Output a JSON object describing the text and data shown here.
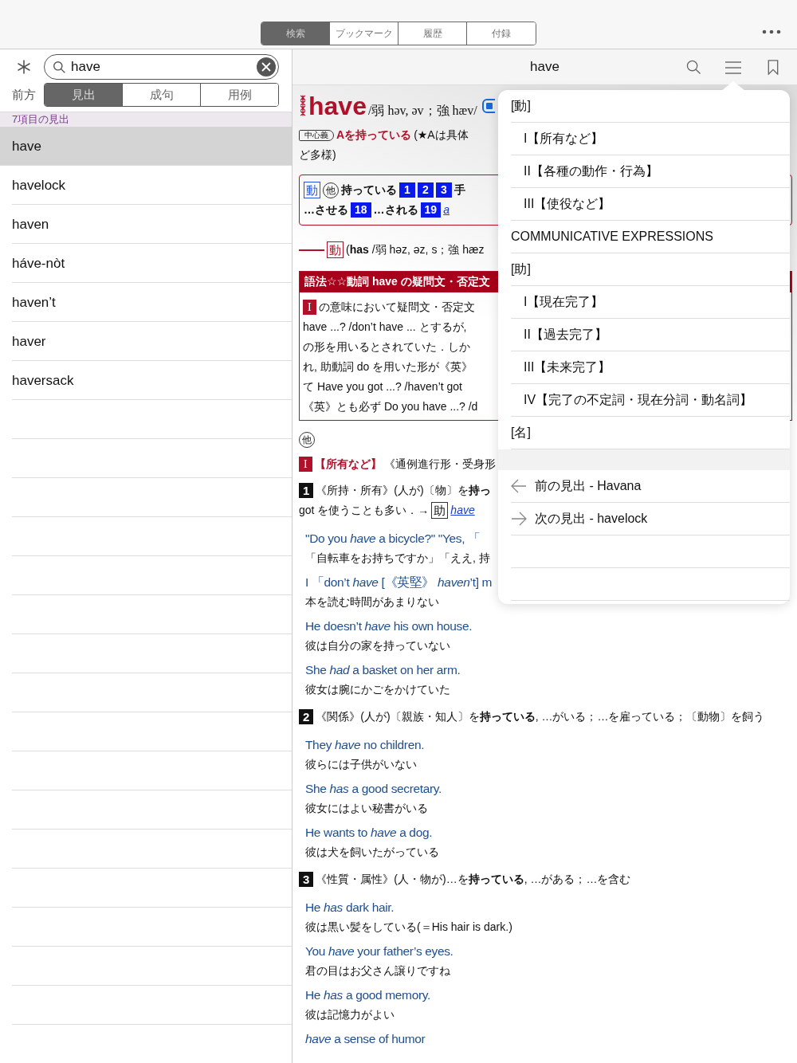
{
  "top_tabs": [
    {
      "label": "検索",
      "selected": true
    },
    {
      "label": "ブックマーク",
      "selected": false
    },
    {
      "label": "履歴",
      "selected": false
    },
    {
      "label": "付録",
      "selected": false
    }
  ],
  "search": {
    "value": "have"
  },
  "filter": {
    "label": "前方",
    "tabs": [
      {
        "label": "見出",
        "selected": true
      },
      {
        "label": "成句",
        "selected": false
      },
      {
        "label": "用例",
        "selected": false
      }
    ]
  },
  "results": {
    "header": "7項目の見出",
    "items": [
      {
        "label": "have",
        "selected": true
      },
      {
        "label": "havelock",
        "selected": false
      },
      {
        "label": "haven",
        "selected": false
      },
      {
        "label": "háve-nòt",
        "selected": false
      },
      {
        "label": "haven’t",
        "selected": false
      },
      {
        "label": "haver",
        "selected": false
      },
      {
        "label": "haversack",
        "selected": false
      }
    ]
  },
  "entry": {
    "title": "have",
    "blocks": [
      {
        "kind": "headword",
        "word": "have",
        "pronunciation": "/弱 həv, əv；強 hæv/"
      },
      {
        "kind": "lines",
        "lines": [
          [
            {
              "kind": "badge",
              "text": "中心義"
            },
            {
              "kind": "red",
              "text": "Aを持っている"
            },
            {
              "kind": "text",
              "text": "(★Aは具体"
            }
          ],
          [
            {
              "kind": "text",
              "text": "ど多様)"
            }
          ]
        ]
      },
      {
        "kind": "box",
        "lines": [
          [
            {
              "kind": "tag",
              "text": "動"
            },
            {
              "kind": "circle",
              "text": "他"
            },
            {
              "kind": "bold",
              "text": "持っている"
            },
            {
              "kind": "num",
              "text": "1"
            },
            {
              "kind": "num",
              "text": "2"
            },
            {
              "kind": "num",
              "text": "3"
            },
            {
              "kind": "bold",
              "text": "手"
            }
          ],
          [
            {
              "kind": "bold",
              "text": "…させる"
            },
            {
              "kind": "num",
              "text": "18"
            },
            {
              "kind": "bold",
              "text": "…される"
            },
            {
              "kind": "num",
              "text": "19"
            },
            {
              "kind": "link",
              "text": "a"
            }
          ]
        ]
      },
      {
        "kind": "lines",
        "lines": [
          [
            {
              "kind": "dash"
            },
            {
              "kind": "redtag",
              "text": "動"
            },
            {
              "kind": "text",
              "text": "(**has** /弱 həz, əz, s；強 hæz"
            }
          ]
        ]
      },
      {
        "kind": "usage",
        "title": "語法☆☆動詞 have の疑問文・否定文",
        "lines": [
          [
            {
              "kind": "roman",
              "text": "I"
            },
            {
              "kind": "text",
              "text": "の意味において疑問文・否定文"
            }
          ],
          [
            {
              "kind": "text",
              "text": "have ...? /don’t have ... とするが,"
            }
          ],
          [
            {
              "kind": "text",
              "text": "の形を用いるとされていた．しか"
            }
          ],
          [
            {
              "kind": "text",
              "text": "れ, 助動詞 do を用いた形が《英》"
            }
          ],
          [
            {
              "kind": "text",
              "text": "て Have you got ...? /haven’t got"
            }
          ],
          [
            {
              "kind": "text",
              "text": "《英》とも必ず Do you have ...? /d"
            }
          ]
        ]
      },
      {
        "kind": "lines",
        "lines": [
          [
            {
              "kind": "circle",
              "text": "他"
            }
          ]
        ]
      },
      {
        "kind": "lines",
        "lines": [
          [
            {
              "kind": "roman",
              "text": "I"
            },
            {
              "kind": "red",
              "text": "【所有など】"
            },
            {
              "kind": "text",
              "text": "《通例進行形・受身形"
            }
          ]
        ]
      },
      {
        "kind": "lines",
        "lines": [
          [
            {
              "kind": "black",
              "text": "1"
            },
            {
              "kind": "text",
              "text": "《所持・所有》(人が)〔物〕を**持っ**"
            }
          ],
          [
            {
              "kind": "text",
              "text": "got を使うことも多い．→"
            },
            {
              "kind": "boxed",
              "text": "助"
            },
            {
              "kind": "link",
              "text": "have"
            }
          ]
        ]
      },
      {
        "kind": "example",
        "en": "\"Do you *have* a bicycle?\" \"Yes, 「",
        "ja": "「自転車をお持ちですか」「ええ, 持"
      },
      {
        "kind": "example",
        "en": "I 「don’t *have* [《英堅》 *haven*’t] m",
        "ja": "本を読む時間があまりない"
      },
      {
        "kind": "example",
        "en": "He doesn’t *have* his own house.",
        "ja": "彼は自分の家を持っていない"
      },
      {
        "kind": "example",
        "en": "She *had* a basket on her arm.",
        "ja": "彼女は腕にかごをかけていた"
      },
      {
        "kind": "lines",
        "lines": [
          [
            {
              "kind": "black",
              "text": "2"
            },
            {
              "kind": "text",
              "text": "《関係》(人が)〔親族・知人〕を**持っている**, …がいる；…を雇っている；〔動物〕を飼う"
            }
          ]
        ]
      },
      {
        "kind": "example",
        "en": "They *have* no children.",
        "ja": "彼らには子供がいない"
      },
      {
        "kind": "example",
        "en": "She *has* a good secretary.",
        "ja": "彼女にはよい秘書がいる"
      },
      {
        "kind": "example",
        "en": "He wants to *have* a dog.",
        "ja": "彼は犬を飼いたがっている"
      },
      {
        "kind": "lines",
        "lines": [
          [
            {
              "kind": "black",
              "text": "3"
            },
            {
              "kind": "text",
              "text": "《性質・属性》(人・物が)…を**持っている**, …がある；…を含む"
            }
          ]
        ]
      },
      {
        "kind": "example",
        "en": "He *has* dark hair.",
        "ja": "彼は黒い髪をしている(＝His hair is dark.)"
      },
      {
        "kind": "example",
        "en": "You *have* your father’s eyes.",
        "ja": "君の目はお父さん譲りですね"
      },
      {
        "kind": "example",
        "en": "He *has* a good memory.",
        "ja": "彼は記憶力がよい"
      },
      {
        "kind": "example",
        "en": "*have* a sense of humor"
      }
    ]
  },
  "contents_menu": [
    {
      "kind": "header",
      "label": "[動]"
    },
    {
      "kind": "sub",
      "label": "I【所有など】"
    },
    {
      "kind": "sub",
      "label": "II【各種の動作・行為】"
    },
    {
      "kind": "sub",
      "label": "III【使役など】"
    },
    {
      "kind": "header",
      "label": "COMMUNICATIVE EXPRESSIONS"
    },
    {
      "kind": "header",
      "label": "[助]"
    },
    {
      "kind": "sub",
      "label": "I【現在完了】"
    },
    {
      "kind": "sub",
      "label": "II【過去完了】"
    },
    {
      "kind": "sub",
      "label": "III【未来完了】"
    },
    {
      "kind": "sub",
      "label": "IV【完了の不定詞・現在分詞・動名詞】"
    },
    {
      "kind": "header",
      "label": "[名]"
    },
    {
      "kind": "prev",
      "label": "前の見出 - Havana"
    },
    {
      "kind": "next",
      "label": "次の見出 - havelock"
    }
  ]
}
